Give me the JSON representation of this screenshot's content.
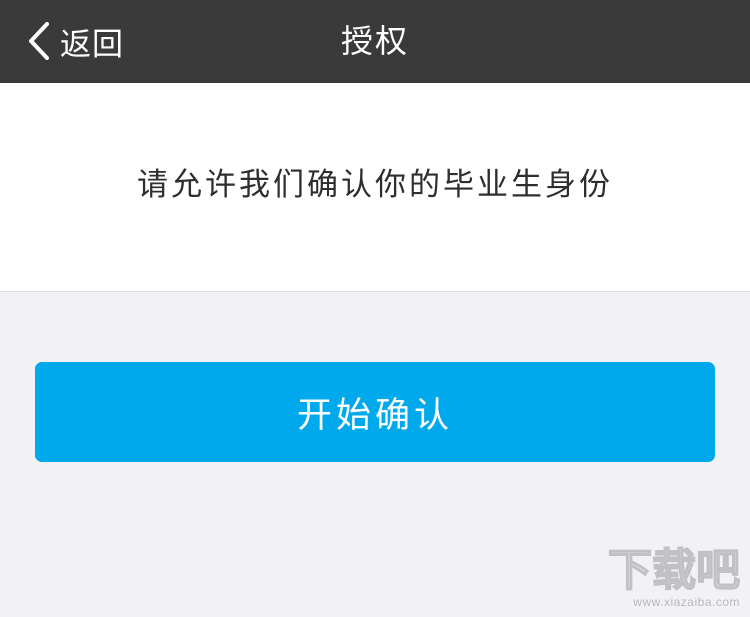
{
  "navbar": {
    "back_label": "返回",
    "title": "授权",
    "background": "#3a3a3a"
  },
  "message": {
    "text": "请允许我们确认你的毕业生身份"
  },
  "actions": {
    "confirm_label": "开始确认",
    "confirm_color": "#00a9ec"
  },
  "watermark": {
    "logo_text": "下载吧",
    "url": "www.xiazaiba.com"
  }
}
